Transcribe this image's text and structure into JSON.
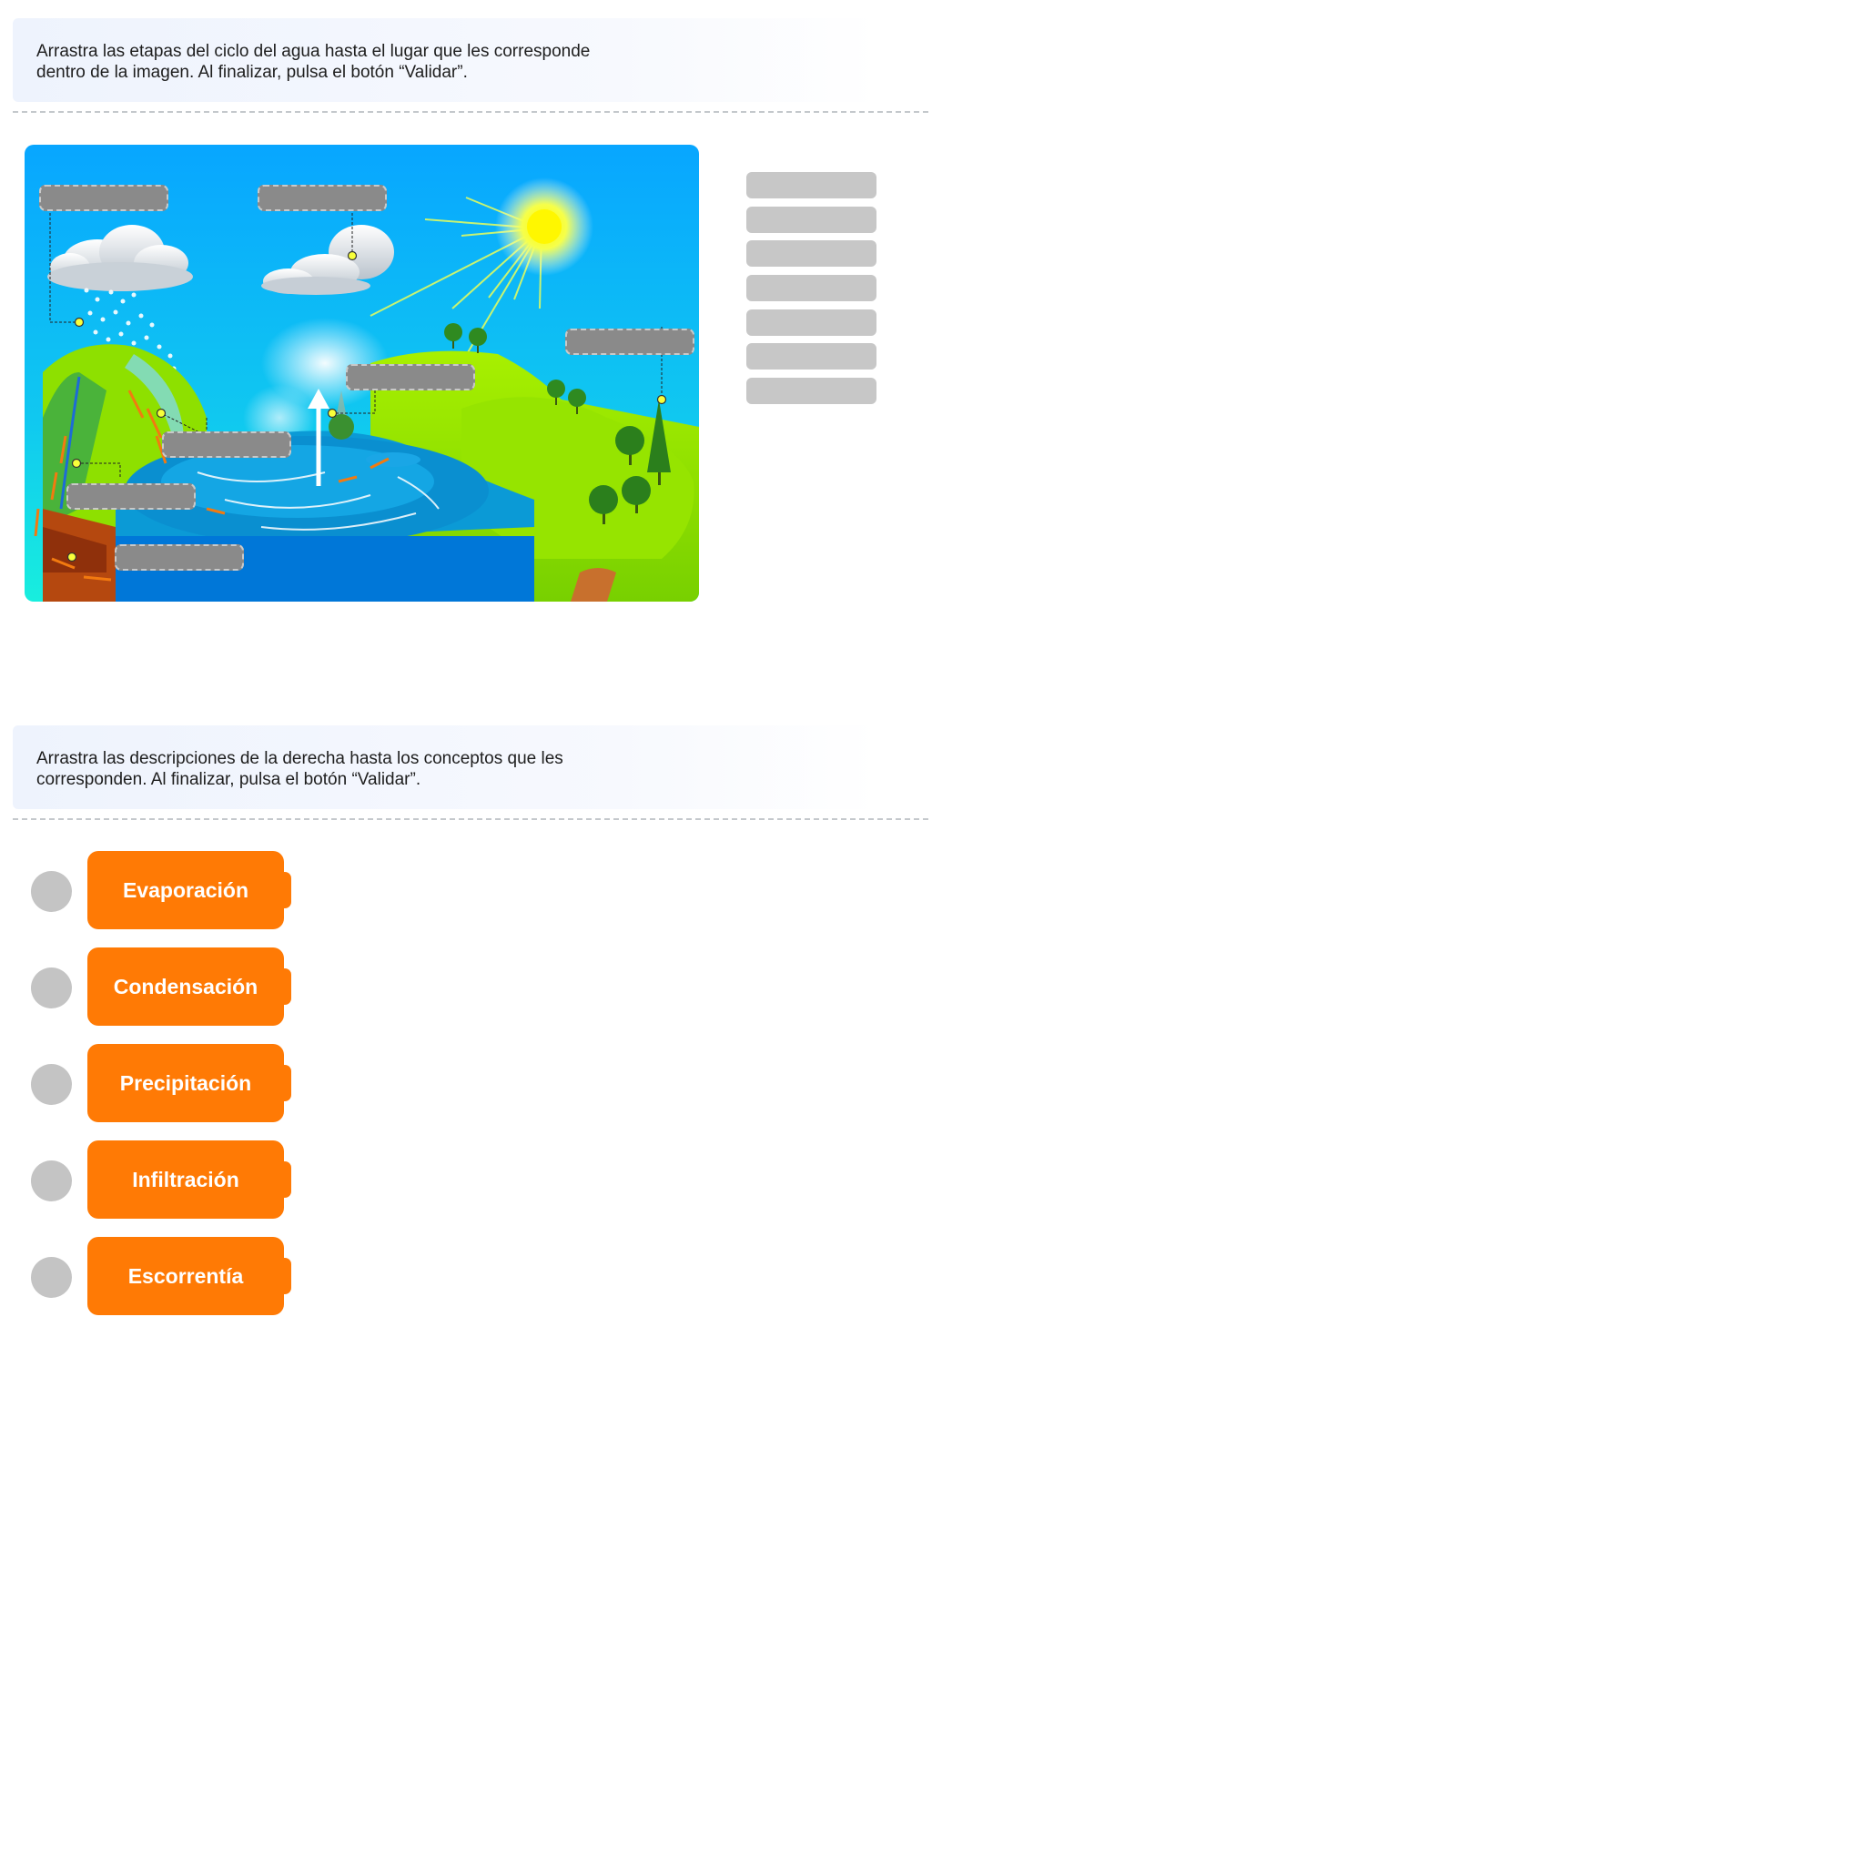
{
  "activity1": {
    "instruction_line1": "Arrastra las etapas del ciclo del agua hasta el lugar que les corresponde",
    "instruction_line2": "dentro de la imagen. Al finalizar, pulsa el botón “Validar”.",
    "scene_icon": "water-cycle-illustration",
    "drop_slot_count": 7,
    "bank_item_count": 7
  },
  "activity2": {
    "instruction_line1": "Arrastra las descripciones de la derecha hasta los conceptos que les",
    "instruction_line2": "corresponden. Al finalizar, pulsa el botón “Validar”.",
    "concepts": [
      {
        "label": "Evaporación"
      },
      {
        "label": "Condensación"
      },
      {
        "label": "Precipitación"
      },
      {
        "label": "Infiltración"
      },
      {
        "label": "Escorrentía"
      }
    ]
  },
  "colors": {
    "concept_orange": "#ff7a05",
    "slot_grey": "#8a8a8a",
    "bank_grey": "#c7c7c7",
    "sky_blue": "#0aaefc",
    "sea_blue": "#0a8fd8",
    "grass_green": "#8ee000"
  }
}
